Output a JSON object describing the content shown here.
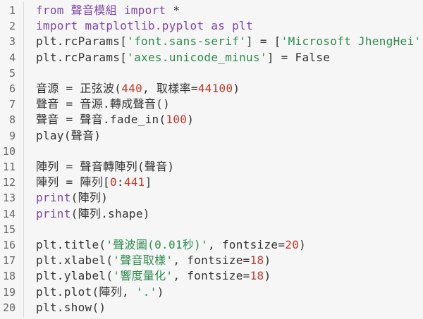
{
  "editor": {
    "lines": [
      {
        "number": "1",
        "tokens": [
          {
            "t": "from",
            "c": "kw"
          },
          {
            "t": " ",
            "c": "plain"
          },
          {
            "t": "聲音模組",
            "c": "kw"
          },
          {
            "t": " ",
            "c": "plain"
          },
          {
            "t": "import",
            "c": "kw"
          },
          {
            "t": " *",
            "c": "plain"
          }
        ]
      },
      {
        "number": "2",
        "tokens": [
          {
            "t": "import",
            "c": "kw"
          },
          {
            "t": " matplotlib.pyplot ",
            "c": "kw"
          },
          {
            "t": "as",
            "c": "kw"
          },
          {
            "t": " plt",
            "c": "kw"
          }
        ]
      },
      {
        "number": "3",
        "tokens": [
          {
            "t": "plt.rcParams[",
            "c": "plain"
          },
          {
            "t": "'font.sans-serif'",
            "c": "str"
          },
          {
            "t": "] = [",
            "c": "plain"
          },
          {
            "t": "'Microsoft JhengHei'",
            "c": "str"
          },
          {
            "t": "]",
            "c": "plain"
          }
        ]
      },
      {
        "number": "4",
        "tokens": [
          {
            "t": "plt.rcParams[",
            "c": "plain"
          },
          {
            "t": "'axes.unicode_minus'",
            "c": "str"
          },
          {
            "t": "] = False",
            "c": "plain"
          }
        ]
      },
      {
        "number": "5",
        "tokens": []
      },
      {
        "number": "6",
        "tokens": [
          {
            "t": "音源 = 正弦波(",
            "c": "plain"
          },
          {
            "t": "440",
            "c": "num"
          },
          {
            "t": ", 取樣率=",
            "c": "plain"
          },
          {
            "t": "44100",
            "c": "num"
          },
          {
            "t": ")",
            "c": "plain"
          }
        ]
      },
      {
        "number": "7",
        "tokens": [
          {
            "t": "聲音 = 音源.轉成聲音()",
            "c": "plain"
          }
        ]
      },
      {
        "number": "8",
        "tokens": [
          {
            "t": "聲音 = 聲音.fade_in(",
            "c": "plain"
          },
          {
            "t": "100",
            "c": "num"
          },
          {
            "t": ")",
            "c": "plain"
          }
        ]
      },
      {
        "number": "9",
        "tokens": [
          {
            "t": "play(聲音)",
            "c": "plain"
          }
        ]
      },
      {
        "number": "10",
        "tokens": []
      },
      {
        "number": "11",
        "tokens": [
          {
            "t": "陣列 = 聲音轉陣列(聲音)",
            "c": "plain"
          }
        ]
      },
      {
        "number": "12",
        "tokens": [
          {
            "t": "陣列 = 陣列[",
            "c": "plain"
          },
          {
            "t": "0",
            "c": "num"
          },
          {
            "t": ":",
            "c": "plain"
          },
          {
            "t": "441",
            "c": "num"
          },
          {
            "t": "]",
            "c": "plain"
          }
        ]
      },
      {
        "number": "13",
        "tokens": [
          {
            "t": "print",
            "c": "kw"
          },
          {
            "t": "(陣列)",
            "c": "plain"
          }
        ]
      },
      {
        "number": "14",
        "tokens": [
          {
            "t": "print",
            "c": "kw"
          },
          {
            "t": "(陣列.shape)",
            "c": "plain"
          }
        ]
      },
      {
        "number": "15",
        "tokens": []
      },
      {
        "number": "16",
        "tokens": [
          {
            "t": "plt.title(",
            "c": "plain"
          },
          {
            "t": "'聲波圖(0.01秒)'",
            "c": "str"
          },
          {
            "t": ", fontsize=",
            "c": "plain"
          },
          {
            "t": "20",
            "c": "num"
          },
          {
            "t": ")",
            "c": "plain"
          }
        ]
      },
      {
        "number": "17",
        "tokens": [
          {
            "t": "plt.xlabel(",
            "c": "plain"
          },
          {
            "t": "'聲音取樣'",
            "c": "str"
          },
          {
            "t": ", fontsize=",
            "c": "plain"
          },
          {
            "t": "18",
            "c": "num"
          },
          {
            "t": ")",
            "c": "plain"
          }
        ]
      },
      {
        "number": "18",
        "tokens": [
          {
            "t": "plt.ylabel(",
            "c": "plain"
          },
          {
            "t": "'響度量化'",
            "c": "str"
          },
          {
            "t": ", fontsize=",
            "c": "plain"
          },
          {
            "t": "18",
            "c": "num"
          },
          {
            "t": ")",
            "c": "plain"
          }
        ]
      },
      {
        "number": "19",
        "tokens": [
          {
            "t": "plt.plot(陣列, ",
            "c": "plain"
          },
          {
            "t": "'.'",
            "c": "str"
          },
          {
            "t": ")",
            "c": "plain"
          }
        ]
      },
      {
        "number": "20",
        "tokens": [
          {
            "t": "plt.show()",
            "c": "plain"
          }
        ]
      }
    ]
  }
}
